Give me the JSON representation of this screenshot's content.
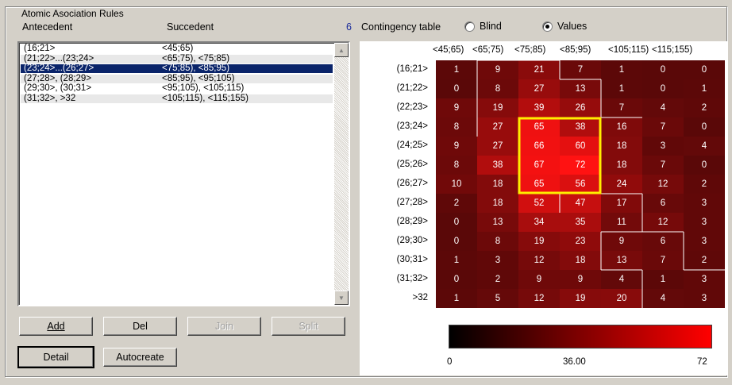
{
  "group_title": "Atomic Asociation Rules",
  "headers": {
    "antecedent": "Antecedent",
    "succedent": "Succedent",
    "count": "6",
    "contingency": "Contingency table"
  },
  "radios": {
    "blind": "Blind",
    "values": "Values",
    "selected": "values"
  },
  "rules": [
    {
      "antecedent": "(16;21>",
      "succedent": "<45;65)"
    },
    {
      "antecedent": "(21;22>...(23;24>",
      "succedent": "<65;75), <75;85)"
    },
    {
      "antecedent": "(23;24>...(26;27>",
      "succedent": "<75;85), <85;95)",
      "selected": true
    },
    {
      "antecedent": "(27;28>, (28;29>",
      "succedent": "<85;95), <95;105)"
    },
    {
      "antecedent": "(29;30>, (30;31>",
      "succedent": "<95;105), <105;115)"
    },
    {
      "antecedent": "(31;32>, >32",
      "succedent": "<105;115), <115;155)"
    }
  ],
  "buttons": {
    "add": "Add",
    "del": "Del",
    "join": "Join",
    "split": "Split",
    "detail": "Detail",
    "autocreate": "Autocreate"
  },
  "col_headers": [
    "<45;65)",
    "<65;75)",
    "<75;85)",
    "<85;95)",
    "<105;115)",
    "<115;155)"
  ],
  "row_headers": [
    "(16;21>",
    "(21;22>",
    "(22;23>",
    "(23;24>",
    "(24;25>",
    "(25;26>",
    "(26;27>",
    "(27;28>",
    "(28;29>",
    "(29;30>",
    "(30;31>",
    "(31;32>",
    ">32"
  ],
  "table": [
    [
      1,
      9,
      21,
      7,
      1,
      0,
      0
    ],
    [
      0,
      8,
      27,
      13,
      1,
      0,
      1
    ],
    [
      9,
      19,
      39,
      26,
      7,
      4,
      2
    ],
    [
      8,
      27,
      65,
      38,
      16,
      7,
      0
    ],
    [
      9,
      27,
      66,
      60,
      18,
      3,
      4
    ],
    [
      8,
      38,
      67,
      72,
      18,
      7,
      0
    ],
    [
      10,
      18,
      65,
      56,
      24,
      12,
      2
    ],
    [
      2,
      18,
      52,
      47,
      17,
      6,
      3
    ],
    [
      0,
      13,
      34,
      35,
      11,
      12,
      3
    ],
    [
      0,
      8,
      19,
      23,
      9,
      6,
      3
    ],
    [
      1,
      3,
      12,
      18,
      13,
      7,
      2
    ],
    [
      0,
      2,
      9,
      9,
      4,
      1,
      3
    ],
    [
      1,
      5,
      12,
      19,
      20,
      4,
      3
    ]
  ],
  "scale": {
    "min": "0",
    "mid": "36.00",
    "max": "72"
  },
  "colors": {
    "selection": "#0a246a",
    "highlight": "#ffee00",
    "heat_low": "#000000",
    "heat_high": "#ff0000"
  }
}
